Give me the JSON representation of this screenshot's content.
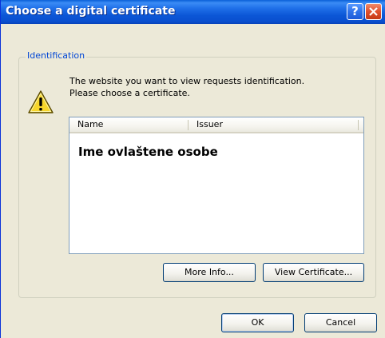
{
  "window": {
    "title": "Choose a digital certificate",
    "help_label": "?"
  },
  "identification": {
    "group_label": "Identification",
    "message_line1": "The website you want to view requests identification.",
    "message_line2": "Please choose a certificate."
  },
  "cert_list": {
    "columns": [
      "Name",
      "Issuer"
    ],
    "items": [
      {
        "name": "Ime ovlaštene osobe",
        "issuer": ""
      }
    ]
  },
  "buttons": {
    "more_info": "More Info...",
    "view_certificate": "View Certificate...",
    "ok": "OK",
    "cancel": "Cancel"
  },
  "icons": {
    "warning": "warning-icon",
    "help": "help-icon",
    "close": "close-icon"
  },
  "colors": {
    "titlebar": "#0a56d6",
    "dialog_bg": "#ece9d8",
    "group_label": "#0046d5",
    "close_button": "#e0502d"
  }
}
